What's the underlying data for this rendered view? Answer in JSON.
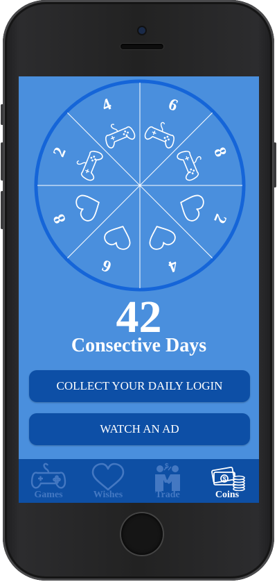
{
  "wheel": {
    "segments": [
      "6",
      "8",
      "2",
      "4",
      "6",
      "8",
      "2",
      "4"
    ],
    "segment_icons": [
      "controller-icon",
      "controller-icon",
      "heart-icon",
      "heart-icon",
      "heart-icon",
      "heart-icon",
      "controller-icon",
      "controller-icon"
    ],
    "colors": {
      "fill": "#4a8fdd",
      "rim": "#1565d8",
      "lines": "#ffffff"
    }
  },
  "streak": {
    "number": "42",
    "label": "Consective Days"
  },
  "buttons": {
    "collect": "COLLECT YOUR DAILY LOGIN",
    "watch_ad": "WATCH AN AD"
  },
  "tabs": [
    {
      "label": "Games",
      "icon": "gamepad-icon",
      "active": false
    },
    {
      "label": "Wishes",
      "icon": "heart-icon",
      "active": false
    },
    {
      "label": "Trade",
      "icon": "trade-icon",
      "active": false
    },
    {
      "label": "Coins",
      "icon": "coins-icon",
      "active": true
    }
  ],
  "colors": {
    "screen_bg": "#4a8fdd",
    "button_bg": "#0d4fa6",
    "tabbar_bg": "#0e4fa4",
    "inactive_tab": "#4478c2",
    "active_tab": "#ffffff"
  }
}
